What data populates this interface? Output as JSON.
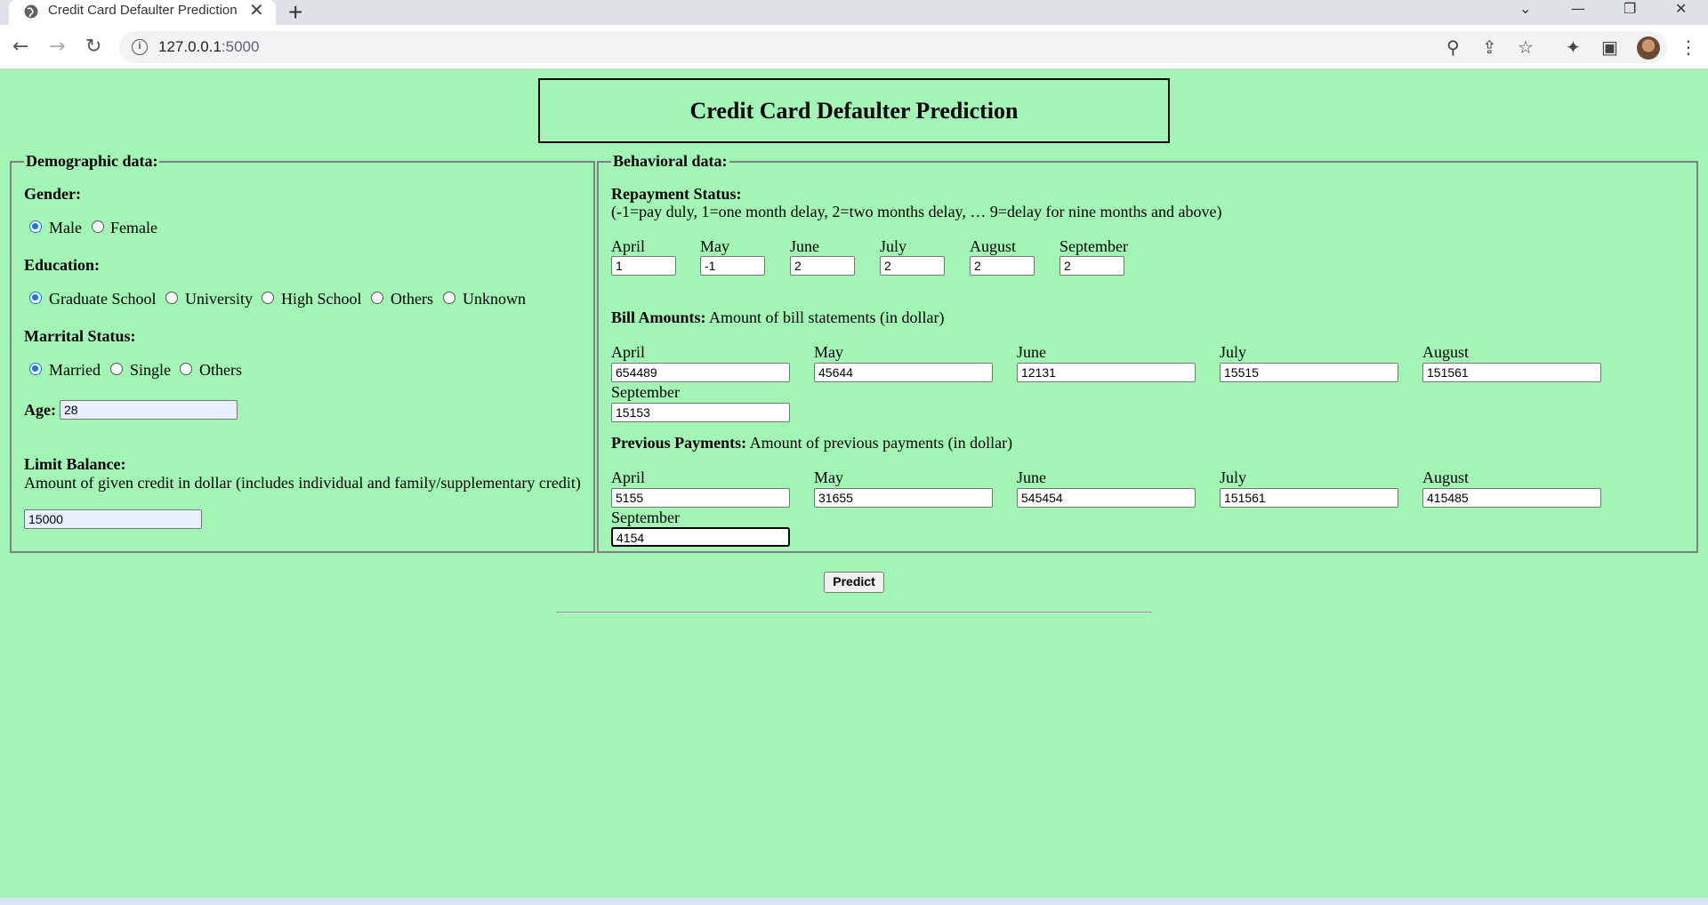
{
  "browser": {
    "tab_title": "Credit Card Defaulter Prediction",
    "tab_close": "✕",
    "new_tab": "+",
    "url_host": "127.0.0.1",
    "url_port": ":5000",
    "icons": [
      "globe-icon",
      "back-icon",
      "forward-icon",
      "reload-icon",
      "info-icon",
      "zoom-icon",
      "share-icon",
      "star-icon",
      "extensions-icon",
      "sidepanel-icon",
      "menu-icon"
    ]
  },
  "page": {
    "title": "Credit Card Defaulter Prediction",
    "background": "#a3f5b5"
  },
  "demographic": {
    "legend": "Demographic data:",
    "gender": {
      "label": "Gender:",
      "options": [
        "Male",
        "Female"
      ],
      "selected": "Male"
    },
    "education": {
      "label": "Education:",
      "options": [
        "Graduate School",
        "University",
        "High School",
        "Others",
        "Unknown"
      ],
      "selected": "Graduate School"
    },
    "marital": {
      "label": "Marrital Status:",
      "options": [
        "Married",
        "Single",
        "Others"
      ],
      "selected": "Married"
    },
    "age": {
      "label": "Age:",
      "value": "28"
    },
    "limit": {
      "label": "Limit Balance:",
      "description": "Amount of given credit in dollar (includes individual and family/supplementary credit)",
      "value": "15000"
    }
  },
  "behavioral": {
    "legend": "Behavioral data:",
    "repayment": {
      "label": "Repayment Status:",
      "description": "(-1=pay duly, 1=one month delay, 2=two months delay, … 9=delay for nine months and above)",
      "months": [
        "April",
        "May",
        "June",
        "July",
        "August",
        "September"
      ],
      "values": [
        "1",
        "-1",
        "2",
        "2",
        "2",
        "2"
      ]
    },
    "bill": {
      "label": "Bill Amounts:",
      "description": "Amount of bill statements (in dollar)",
      "months": [
        "April",
        "May",
        "June",
        "July",
        "August",
        "September"
      ],
      "values": [
        "654489",
        "45644",
        "12131",
        "15515",
        "151561",
        "15153"
      ]
    },
    "payments": {
      "label": "Previous Payments:",
      "description": "Amount of previous payments (in dollar)",
      "months": [
        "April",
        "May",
        "June",
        "July",
        "August",
        "September"
      ],
      "values": [
        "5155",
        "31655",
        "545454",
        "151561",
        "415485",
        "4154"
      ]
    }
  },
  "predict_button": "Predict"
}
